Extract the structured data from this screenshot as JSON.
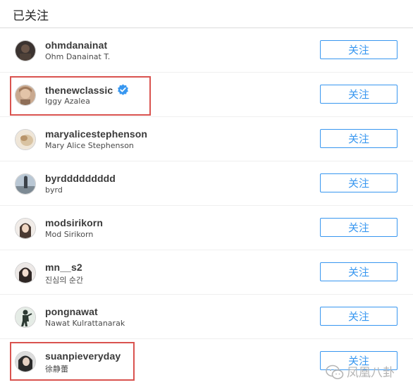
{
  "header": {
    "title": "已关注"
  },
  "follow_label": "关注",
  "accent_color": "#3897f0",
  "highlight_color": "#d9534f",
  "users": [
    {
      "username": "ohmdanainat",
      "full_name": "Ohm Danainat T.",
      "verified": false,
      "avatar": "avatar-icon"
    },
    {
      "username": "thenewclassic",
      "full_name": "Iggy Azalea",
      "verified": true,
      "avatar": "avatar-icon"
    },
    {
      "username": "maryalicestephenson",
      "full_name": "Mary Alice Stephenson",
      "verified": false,
      "avatar": "avatar-icon"
    },
    {
      "username": "byrddddddddd",
      "full_name": "byrd",
      "verified": false,
      "avatar": "avatar-icon"
    },
    {
      "username": "modsirikorn",
      "full_name": "Mod Sirikorn",
      "verified": false,
      "avatar": "avatar-icon"
    },
    {
      "username": "mn__s2",
      "full_name": "진심의 순간",
      "verified": false,
      "avatar": "avatar-icon"
    },
    {
      "username": "pongnawat",
      "full_name": "Nawat Kulrattanarak",
      "verified": false,
      "avatar": "avatar-icon"
    },
    {
      "username": "suanpieveryday",
      "full_name": "徐静蕾",
      "verified": false,
      "avatar": "avatar-icon"
    }
  ],
  "watermark": {
    "text": "凤凰八卦",
    "icon": "wechat-icon"
  }
}
